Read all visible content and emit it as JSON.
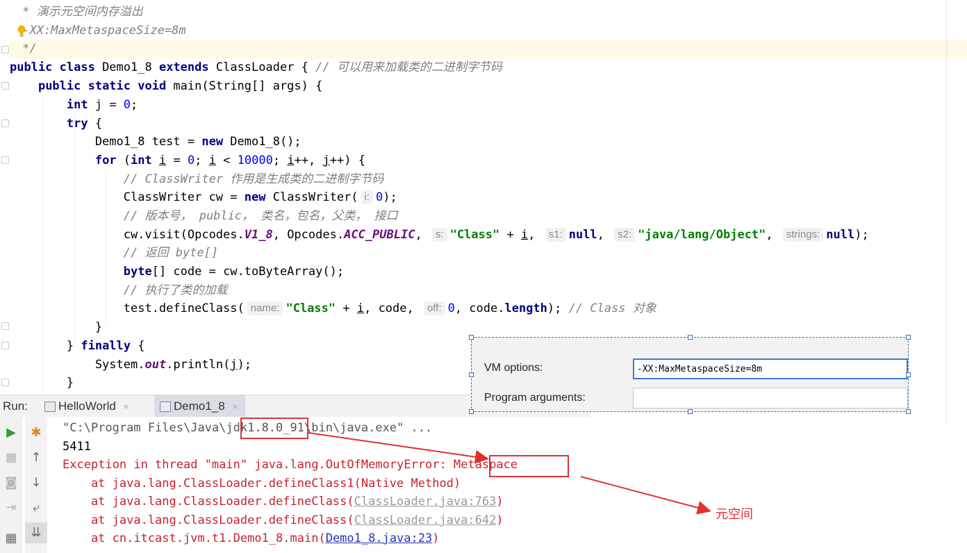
{
  "editor": {
    "lines": [
      [
        {
          "t": " * 演示元空间内存溢出",
          "c": "cm"
        }
      ],
      [
        {
          "t": " -XX:MaxMetaspaceSize=8m",
          "c": "cm"
        }
      ],
      [
        {
          "t": " */",
          "c": "cm"
        }
      ],
      [
        {
          "t": "public class ",
          "c": "kw"
        },
        {
          "t": "Demo1_8 "
        },
        {
          "t": "extends ",
          "c": "kw"
        },
        {
          "t": "ClassLoader { "
        },
        {
          "t": "// 可以用来加载类的二进制字节码",
          "c": "cm"
        }
      ],
      [
        {
          "t": "    "
        },
        {
          "t": "public static void ",
          "c": "kw"
        },
        {
          "t": "main(String[] args) {"
        }
      ],
      [
        {
          "t": "        "
        },
        {
          "t": "int ",
          "c": "kw"
        },
        {
          "t": "j = "
        },
        {
          "t": "0",
          "c": "num"
        },
        {
          "t": ";"
        }
      ],
      [
        {
          "t": "        "
        },
        {
          "t": "try ",
          "c": "kw"
        },
        {
          "t": "{"
        }
      ],
      [
        {
          "t": "            Demo1_8 test = "
        },
        {
          "t": "new ",
          "c": "kw"
        },
        {
          "t": "Demo1_8();"
        }
      ],
      [
        {
          "t": "            "
        },
        {
          "t": "for ",
          "c": "kw"
        },
        {
          "t": "("
        },
        {
          "t": "int ",
          "c": "kw"
        },
        {
          "t": "i",
          "c": "ul"
        },
        {
          "t": " = "
        },
        {
          "t": "0",
          "c": "num"
        },
        {
          "t": "; "
        },
        {
          "t": "i",
          "c": "ul"
        },
        {
          "t": " < "
        },
        {
          "t": "10000",
          "c": "num"
        },
        {
          "t": "; "
        },
        {
          "t": "i",
          "c": "ul"
        },
        {
          "t": "++, "
        },
        {
          "t": "j",
          "c": "ul"
        },
        {
          "t": "++) {"
        }
      ],
      [
        {
          "t": "                "
        },
        {
          "t": "// ClassWriter 作用是生成类的二进制字节码",
          "c": "cm"
        }
      ],
      [
        {
          "t": "                ClassWriter cw = "
        },
        {
          "t": "new ",
          "c": "kw"
        },
        {
          "t": "ClassWriter("
        },
        {
          "t": "i:",
          "c": "hint"
        },
        {
          "t": "0",
          "c": "num"
        },
        {
          "t": ");"
        }
      ],
      [
        {
          "t": "                "
        },
        {
          "t": "// 版本号， public， 类名，包名，父类， 接口",
          "c": "cm"
        }
      ],
      [
        {
          "t": "                cw.visit(Opcodes."
        },
        {
          "t": "V1_8",
          "c": "st"
        },
        {
          "t": ", Opcodes."
        },
        {
          "t": "ACC_PUBLIC",
          "c": "st"
        },
        {
          "t": ", "
        },
        {
          "t": "s:",
          "c": "hint"
        },
        {
          "t": "\"Class\"",
          "c": "str"
        },
        {
          "t": " + "
        },
        {
          "t": "i",
          "c": "ul"
        },
        {
          "t": ", "
        },
        {
          "t": "s1:",
          "c": "hint"
        },
        {
          "t": "null",
          "c": "kw"
        },
        {
          "t": ", "
        },
        {
          "t": "s2:",
          "c": "hint"
        },
        {
          "t": "\"java/lang/Object\"",
          "c": "str"
        },
        {
          "t": ", "
        },
        {
          "t": "strings:",
          "c": "hint"
        },
        {
          "t": "null",
          "c": "kw"
        },
        {
          "t": ");"
        }
      ],
      [
        {
          "t": "                "
        },
        {
          "t": "// 返回 byte[]",
          "c": "cm"
        }
      ],
      [
        {
          "t": "                "
        },
        {
          "t": "byte",
          "c": "kw"
        },
        {
          "t": "[] code = cw.toByteArray();"
        }
      ],
      [
        {
          "t": "                "
        },
        {
          "t": "// 执行了类的加载",
          "c": "cm"
        }
      ],
      [
        {
          "t": "                test.defineClass("
        },
        {
          "t": "name:",
          "c": "hint"
        },
        {
          "t": "\"Class\"",
          "c": "str"
        },
        {
          "t": " + "
        },
        {
          "t": "i",
          "c": "ul"
        },
        {
          "t": ", code, "
        },
        {
          "t": "off:",
          "c": "hint"
        },
        {
          "t": "0",
          "c": "num"
        },
        {
          "t": ", code."
        },
        {
          "t": "length",
          "c": "kw"
        },
        {
          "t": "); "
        },
        {
          "t": "// Class 对象",
          "c": "cm"
        }
      ],
      [
        {
          "t": "            }"
        }
      ],
      [
        {
          "t": "        } "
        },
        {
          "t": "finally ",
          "c": "kw"
        },
        {
          "t": "{"
        }
      ],
      [
        {
          "t": "            System."
        },
        {
          "t": "out",
          "c": "st"
        },
        {
          "t": ".println("
        },
        {
          "t": "j",
          "c": "ul"
        },
        {
          "t": ");"
        }
      ],
      [
        {
          "t": "        }"
        }
      ]
    ]
  },
  "run": {
    "label": "Run:",
    "tabs": [
      {
        "label": "HelloWorld",
        "active": false
      },
      {
        "label": "Demo1_8",
        "active": true
      }
    ],
    "close_glyph": "×"
  },
  "console": {
    "lines": [
      [
        {
          "t": "\"C:\\Program Files\\Java\\jdk1.8.0_91\\bin\\java.exe\" ...",
          "c": "gray"
        }
      ],
      [
        {
          "t": "5411"
        }
      ],
      [
        {
          "t": "Exception in thread \"main\" java.lang.OutOfMemoryError: Metaspace",
          "c": "err"
        }
      ],
      [
        {
          "t": "    at java.lang.ClassLoader.defineClass1(Native Method)",
          "c": "err"
        }
      ],
      [
        {
          "t": "    at java.lang.ClassLoader.defineClass(",
          "c": "err"
        },
        {
          "t": "ClassLoader.java:763",
          "c": "glink"
        },
        {
          "t": ")",
          "c": "err"
        }
      ],
      [
        {
          "t": "    at java.lang.ClassLoader.defineClass(",
          "c": "err"
        },
        {
          "t": "ClassLoader.java:642",
          "c": "glink"
        },
        {
          "t": ")",
          "c": "err"
        }
      ],
      [
        {
          "t": "    at cn.itcast.jvm.t1.Demo1_8.main(",
          "c": "err"
        },
        {
          "t": "Demo1_8.java:23",
          "c": "blink"
        },
        {
          "t": ")",
          "c": "err"
        }
      ]
    ]
  },
  "vm": {
    "vm_options_label": "VM options:",
    "vm_options_value": "-XX:MaxMetaspaceSize=8m",
    "program_arguments_label": "Program arguments:",
    "program_arguments_value": ""
  },
  "annotation": {
    "note": "元空间"
  }
}
